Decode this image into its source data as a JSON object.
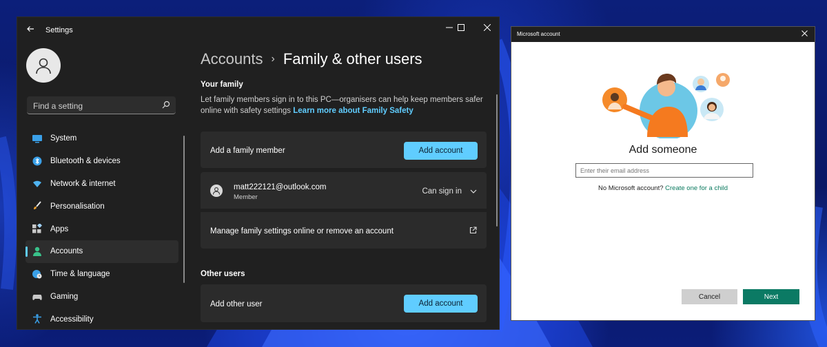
{
  "settings": {
    "title": "Settings",
    "search_placeholder": "Find a setting",
    "nav": [
      {
        "label": "System"
      },
      {
        "label": "Bluetooth & devices"
      },
      {
        "label": "Network & internet"
      },
      {
        "label": "Personalisation"
      },
      {
        "label": "Apps"
      },
      {
        "label": "Accounts",
        "active": true
      },
      {
        "label": "Time & language"
      },
      {
        "label": "Gaming"
      },
      {
        "label": "Accessibility"
      }
    ],
    "breadcrumb": {
      "parent": "Accounts",
      "separator": "›",
      "current": "Family & other users"
    },
    "family": {
      "title": "Your family",
      "description": "Let family members sign in to this PC—organisers can help keep members safer online with safety settings",
      "link": "Learn more about Family Safety",
      "add_label": "Add a family member",
      "add_button": "Add account",
      "member_email": "matt222121@outlook.com",
      "member_role": "Member",
      "member_status": "Can sign in",
      "manage_label": "Manage family settings online or remove an account"
    },
    "other_users": {
      "title": "Other users",
      "add_label": "Add other user",
      "add_button": "Add account"
    }
  },
  "msa_dialog": {
    "title": "Microsoft account",
    "heading": "Add someone",
    "email_placeholder": "Enter their email address",
    "no_account_text": "No Microsoft account?",
    "create_child_link": "Create one for a child",
    "cancel": "Cancel",
    "next": "Next"
  },
  "colors": {
    "accent": "#60cdff",
    "dialog_primary": "#0b7a64",
    "window_bg": "#202020",
    "card_bg": "#2b2b2b"
  }
}
